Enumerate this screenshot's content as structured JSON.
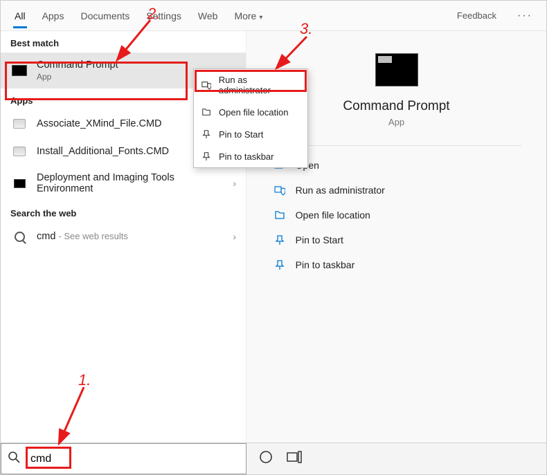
{
  "tabs": {
    "all": "All",
    "apps": "Apps",
    "documents": "Documents",
    "settings": "Settings",
    "web": "Web",
    "more": "More",
    "feedback": "Feedback"
  },
  "left": {
    "best_match_label": "Best match",
    "best": {
      "title": "Command Prompt",
      "sub": "App"
    },
    "apps_label": "Apps",
    "apps": [
      {
        "title": "Associate_XMind_File.CMD"
      },
      {
        "title": "Install_Additional_Fonts.CMD"
      },
      {
        "title": "Deployment and Imaging Tools Environment"
      }
    ],
    "web_label": "Search the web",
    "web": {
      "term": "cmd",
      "hint": "- See web results"
    }
  },
  "context": {
    "run_admin": "Run as administrator",
    "open_loc": "Open file location",
    "pin_start": "Pin to Start",
    "pin_taskbar": "Pin to taskbar"
  },
  "right": {
    "title": "Command Prompt",
    "sub": "App",
    "actions": {
      "open": "Open",
      "run_admin": "Run as administrator",
      "open_loc": "Open file location",
      "pin_start": "Pin to Start",
      "pin_taskbar": "Pin to taskbar"
    }
  },
  "search": {
    "value": "cmd"
  },
  "annotations": {
    "n1": "1.",
    "n2": "2.",
    "n3": "3."
  }
}
